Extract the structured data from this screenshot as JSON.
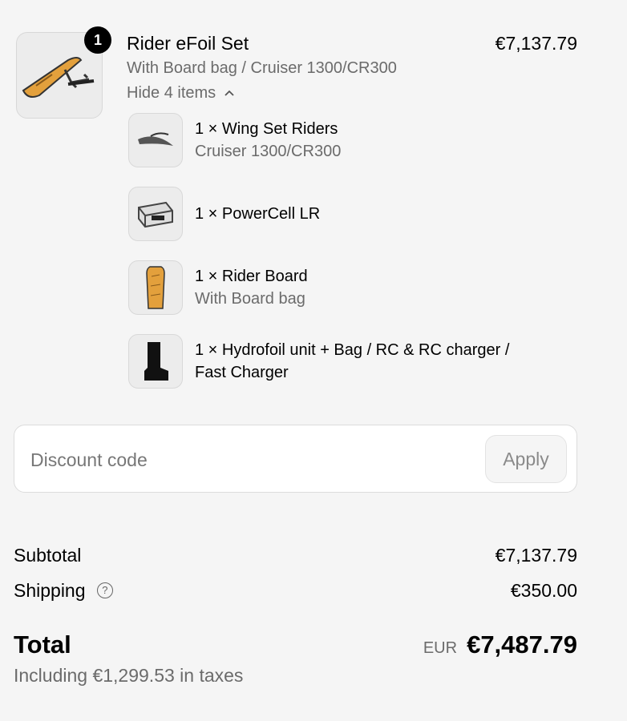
{
  "product": {
    "title": "Rider eFoil Set",
    "price": "€7,137.79",
    "variant": "With Board bag / Cruiser 1300/CR300",
    "quantity": "1",
    "toggle_label": "Hide 4 items",
    "toggle_icon": "chevron-up-icon",
    "items": [
      {
        "label": "1 × Wing Set Riders",
        "sub": "Cruiser 1300/CR300",
        "icon": "wing-set-image"
      },
      {
        "label": "1 × PowerCell LR",
        "sub": "",
        "icon": "powercell-image"
      },
      {
        "label": "1 × Rider Board",
        "sub": "With Board bag",
        "icon": "rider-board-image"
      },
      {
        "label": "1 × Hydrofoil unit + Bag / RC & RC charger / Fast Charger",
        "sub": "",
        "icon": "hydrofoil-unit-image"
      }
    ]
  },
  "discount": {
    "placeholder": "Discount code",
    "apply_label": "Apply"
  },
  "summary": {
    "subtotal_label": "Subtotal",
    "subtotal_value": "€7,137.79",
    "shipping_label": "Shipping",
    "shipping_value": "€350.00",
    "help_icon": "question-circle-icon",
    "total_label": "Total",
    "currency": "EUR",
    "total_value": "€7,487.79",
    "taxes_note": "Including €1,299.53 in taxes"
  },
  "colors": {
    "background": "#f5f5f5",
    "muted_text": "#6b6b6b",
    "badge": "#000000",
    "board_orange": "#e3a03c"
  }
}
